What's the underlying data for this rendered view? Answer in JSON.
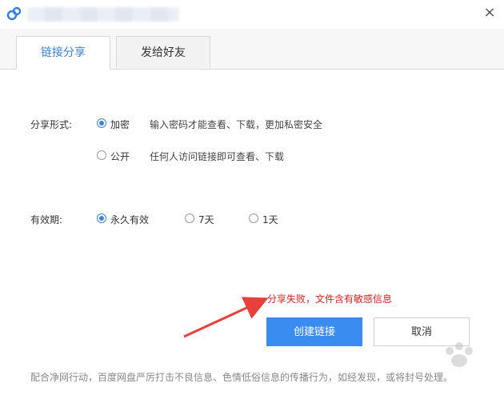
{
  "window": {
    "close_glyph": "×"
  },
  "tabs": [
    {
      "label": "链接分享",
      "active": true
    },
    {
      "label": "发给好友",
      "active": false
    }
  ],
  "share_form": {
    "label": "分享形式:",
    "options": [
      {
        "label": "加密",
        "desc": "输入密码才能查看、下载，更加私密安全",
        "selected": true
      },
      {
        "label": "公开",
        "desc": "任何人访问链接即可查看、下载",
        "selected": false
      }
    ]
  },
  "validity": {
    "label": "有效期:",
    "options": [
      {
        "label": "永久有效",
        "selected": true
      },
      {
        "label": "7天",
        "selected": false
      },
      {
        "label": "1天",
        "selected": false
      }
    ]
  },
  "error_message": "分享失败，文件含有敏感信息",
  "buttons": {
    "create": "创建链接",
    "cancel": "取消"
  },
  "footer_text": "配合净网行动，百度网盘严厉打击不良信息、色情低俗信息的传播行为，如经发现，或将封号处理。",
  "colors": {
    "accent": "#3a83d6",
    "primary_button": "#3b8cf0",
    "error": "#e02020",
    "annotation_arrow": "#e8403a"
  }
}
